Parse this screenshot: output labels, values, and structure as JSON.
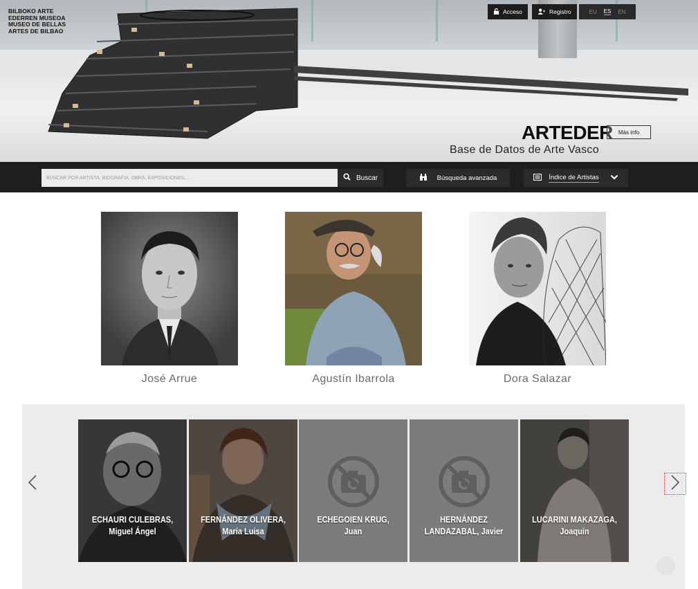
{
  "header": {
    "logo_lines": [
      "BILBOKO ARTE",
      "EDERREN MUSEOA",
      "MUSEO DE BELLAS",
      "ARTES DE BILBAO"
    ],
    "access_label": "Acceso",
    "register_label": "Registro",
    "languages": [
      {
        "code": "EU",
        "active": false
      },
      {
        "code": "ES",
        "active": true
      },
      {
        "code": "EN",
        "active": false
      }
    ],
    "brand_title": "ARTEDER",
    "brand_subtitle": "Base de Datos de Arte Vasco",
    "more_info_label": "Más info"
  },
  "search": {
    "placeholder": "BUSCAR POR ARTISTA, BIOGRAFÍA, OBRA, EXPOSICIONES,...",
    "search_label": "Buscar",
    "advanced_label": "Búsqueda avanzada",
    "artist_index_label": "Índice de Artistas"
  },
  "featured": [
    {
      "name": "José Arrue"
    },
    {
      "name": "Agustín Ibarrola"
    },
    {
      "name": "Dora Salazar"
    }
  ],
  "carousel": {
    "cards": [
      {
        "line1": "ECHAURI CULEBRAS,",
        "line2": "Miguel Ángel",
        "has_photo": true
      },
      {
        "line1": "FERNÁNDEZ OLIVERA,",
        "line2": "María Luisa",
        "has_photo": true
      },
      {
        "line1": "ECHEGOIEN KRUG,",
        "line2": "Juan",
        "has_photo": false
      },
      {
        "line1": "HERNÁNDEZ",
        "line2": "LANDAZABAL, Javier",
        "has_photo": false
      },
      {
        "line1": "LUCARINI MAKAZAGA,",
        "line2": "Joaquín",
        "has_photo": true
      }
    ]
  },
  "colors": {
    "dark_bar": "#1e1e1e",
    "accent_underline": "#e0a400",
    "carousel_bg": "#ececec",
    "caption_gray": "#6a6a6a"
  },
  "icons": [
    "lock-icon",
    "user-add-icon",
    "search-icon",
    "binoculars-icon",
    "book-index-icon",
    "chevron-down-icon",
    "no-photo-icon",
    "chevron-left-icon",
    "chevron-right-icon"
  ]
}
